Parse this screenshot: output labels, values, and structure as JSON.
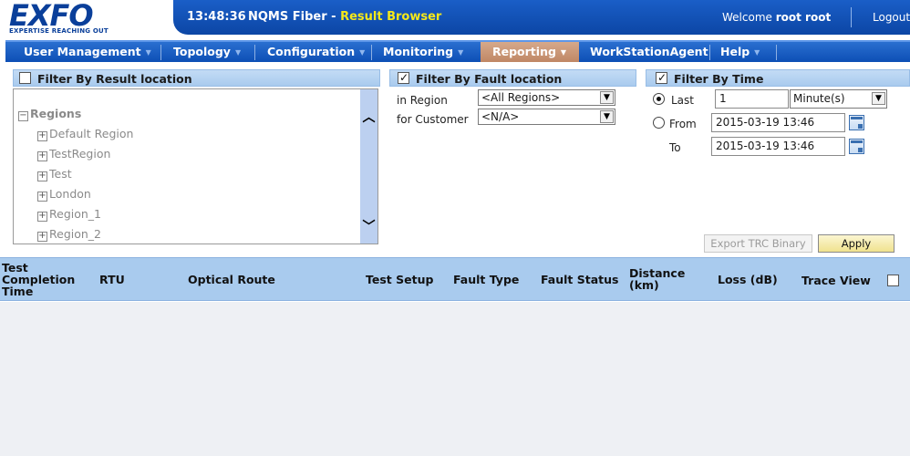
{
  "header": {
    "logo_text": "EXFO",
    "logo_tagline": "EXPERTISE REACHING OUT",
    "time": "13:48:36",
    "app_name": "NQMS Fiber - ",
    "page_name": "Result Browser",
    "welcome_prefix": "Welcome ",
    "user_name": "root root",
    "logout_label": "Logout"
  },
  "nav": {
    "items": [
      {
        "label": "User Management"
      },
      {
        "label": "Topology"
      },
      {
        "label": "Configuration"
      },
      {
        "label": "Monitoring"
      },
      {
        "label": "Reporting"
      },
      {
        "label": "WorkStationAgent"
      },
      {
        "label": "Help"
      }
    ],
    "active": "Reporting"
  },
  "filter_result_location": {
    "title": "Filter By Result location",
    "checked": false,
    "tree": {
      "root": "Regions",
      "children": [
        "Default Region",
        "TestRegion",
        "Test",
        "London",
        "Region_1",
        "Region_2"
      ]
    }
  },
  "filter_fault_location": {
    "title": "Filter By Fault location",
    "checked": true,
    "region_label": "in Region",
    "region_value": "<All Regions>",
    "customer_label": "for Customer",
    "customer_value": "<N/A>"
  },
  "filter_time": {
    "title": "Filter By Time",
    "checked": true,
    "last_label": "Last",
    "last_selected": true,
    "last_value": "1",
    "unit_value": "Minute(s)",
    "from_label": "From",
    "from_value": "2015-03-19 13:46",
    "to_label": "To",
    "to_value": "2015-03-19 13:46"
  },
  "buttons": {
    "export_label": "Export TRC Binary",
    "apply_label": "Apply"
  },
  "table": {
    "columns": [
      {
        "label": "Test Completion Time"
      },
      {
        "label": "RTU"
      },
      {
        "label": "Optical Route"
      },
      {
        "label": "Test Setup"
      },
      {
        "label": "Fault Type"
      },
      {
        "label": "Fault Status"
      },
      {
        "label": "Distance (km)"
      },
      {
        "label": "Loss (dB)"
      },
      {
        "label": "Trace View"
      }
    ],
    "rows": []
  },
  "colors": {
    "brand_blue": "#0c46a5",
    "header_accent_yellow": "#f4e81a",
    "nav_active": "#c08765",
    "filter_header": "#a9cbee"
  }
}
